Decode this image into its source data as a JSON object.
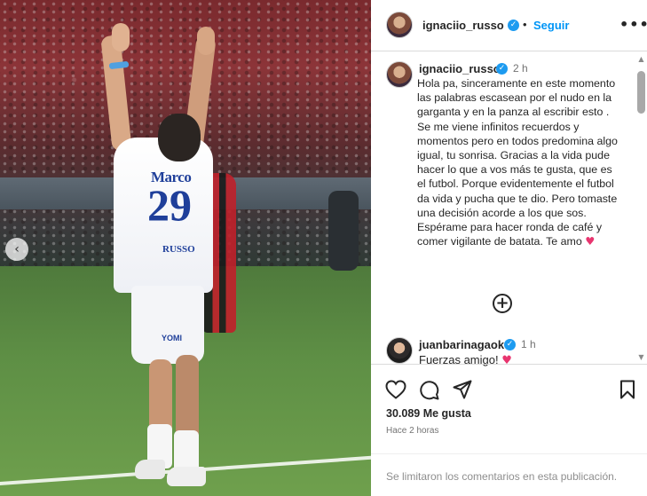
{
  "header": {
    "username": "ignaciio_russo",
    "follow_label": "Seguir",
    "more_label": "•••"
  },
  "photo": {
    "shirt_name": "Marco",
    "shirt_number": "29",
    "shirt_sub": "RUSSO",
    "shorts_logo": "YOMI",
    "prev_icon": "‹"
  },
  "caption": {
    "username": "ignaciio_russo",
    "time": "2 h",
    "text": "Hola pa, sinceramente en este momento las palabras escasean por el nudo en la garganta y en la panza al escribir esto . Se me viene infinitos recuerdos y momentos pero en todos predomina algo igual, tu sonrisa. Gracias a la vida pude hacer lo que a vos más te gusta, que es el futbol. Porque evidentemente el futbol da vida y pucha que te dio. Pero tomaste una decisión acorde a los que sos. Espérame para hacer ronda de café y comer vigilante de batata. Te amo",
    "emoji": "♥"
  },
  "load_more_icon": "+",
  "comment": {
    "username": "juanbarinagaok",
    "time": "1 h",
    "text": "Fuerzas amigo!",
    "emoji": "♥"
  },
  "actions": {
    "likes": "30.089 Me gusta",
    "posted_ago": "Hace 2 horas",
    "comments_limited": "Se limitaron los comentarios en esta publicación."
  },
  "icons": {
    "like": "heart-icon",
    "comment": "comment-icon",
    "share": "share-icon",
    "save": "bookmark-icon"
  },
  "colors": {
    "accent": "#0095f6",
    "verified": "#1d9bf0",
    "heart": "#e8356f"
  }
}
